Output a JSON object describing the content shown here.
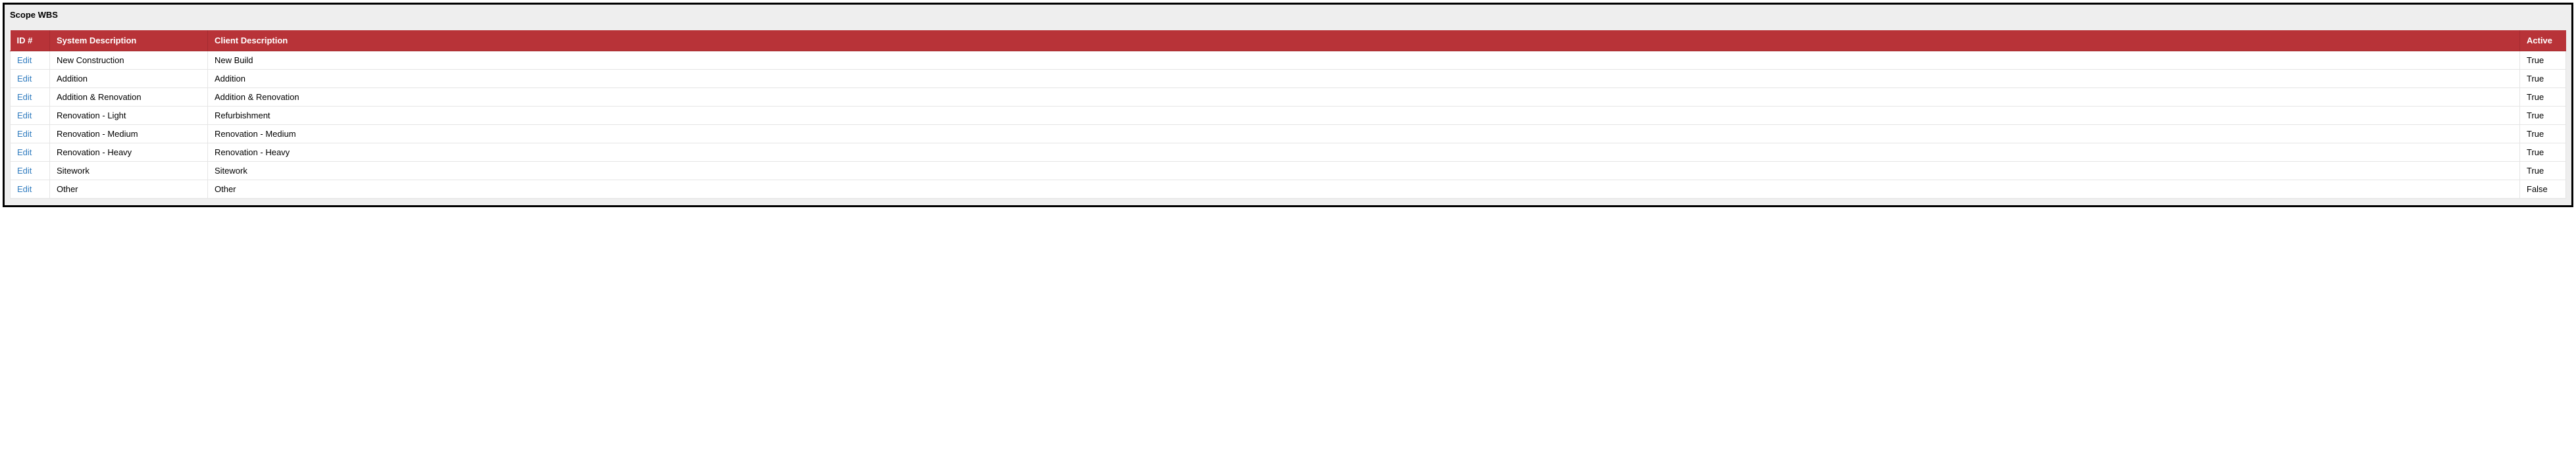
{
  "panel": {
    "title": "Scope WBS"
  },
  "table": {
    "headers": {
      "id": "ID #",
      "system_description": "System Description",
      "client_description": "Client Description",
      "active": "Active"
    },
    "edit_label": "Edit",
    "rows": [
      {
        "system": "New Construction",
        "client": "New Build",
        "active": "True"
      },
      {
        "system": "Addition",
        "client": "Addition",
        "active": "True"
      },
      {
        "system": "Addition & Renovation",
        "client": "Addition & Renovation",
        "active": "True"
      },
      {
        "system": "Renovation - Light",
        "client": "Refurbishment",
        "active": "True"
      },
      {
        "system": "Renovation - Medium",
        "client": "Renovation - Medium",
        "active": "True"
      },
      {
        "system": "Renovation - Heavy",
        "client": "Renovation - Heavy",
        "active": "True"
      },
      {
        "system": "Sitework",
        "client": "Sitework",
        "active": "True"
      },
      {
        "system": "Other",
        "client": "Other",
        "active": "False"
      }
    ]
  }
}
